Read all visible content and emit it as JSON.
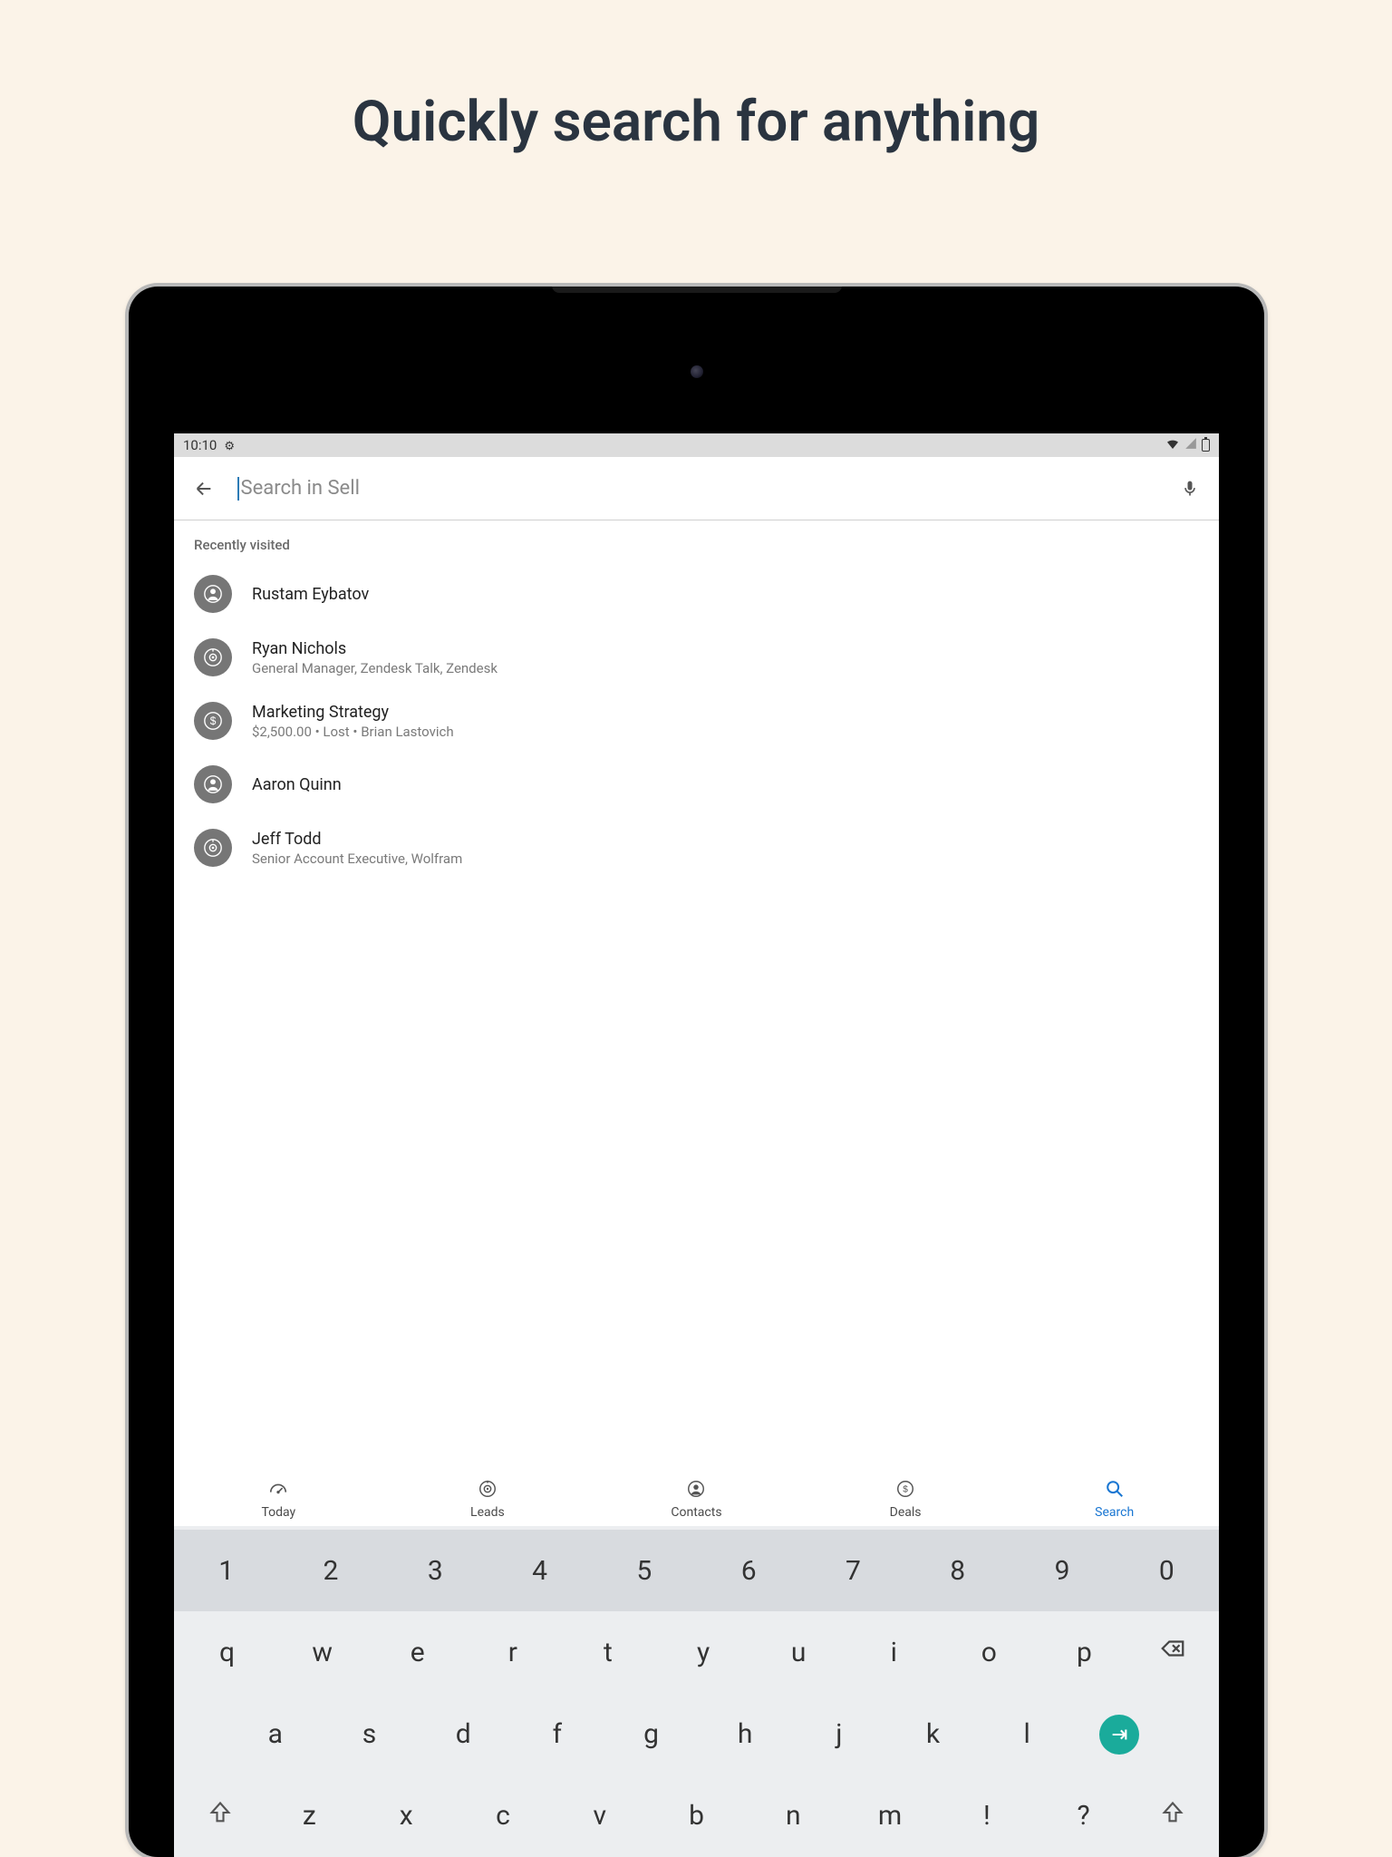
{
  "headline": "Quickly search for anything",
  "status": {
    "time": "10:10"
  },
  "search": {
    "placeholder": "Search in Sell"
  },
  "section_header": "Recently visited",
  "items": [
    {
      "icon": "contact",
      "title": "Rustam Eybatov",
      "subtitle": ""
    },
    {
      "icon": "lead",
      "title": "Ryan Nichols",
      "subtitle": "General Manager, Zendesk Talk, Zendesk"
    },
    {
      "icon": "deal",
      "title": "Marketing Strategy",
      "subtitle": "$2,500.00 • Lost • Brian Lastovich"
    },
    {
      "icon": "contact",
      "title": "Aaron Quinn",
      "subtitle": ""
    },
    {
      "icon": "lead",
      "title": "Jeff Todd",
      "subtitle": "Senior Account Executive, Wolfram"
    }
  ],
  "nav": {
    "items": [
      {
        "label": "Today",
        "icon": "gauge"
      },
      {
        "label": "Leads",
        "icon": "lead"
      },
      {
        "label": "Contacts",
        "icon": "contact"
      },
      {
        "label": "Deals",
        "icon": "deal"
      },
      {
        "label": "Search",
        "icon": "search",
        "active": true
      }
    ]
  },
  "keyboard": {
    "row1": [
      "1",
      "2",
      "3",
      "4",
      "5",
      "6",
      "7",
      "8",
      "9",
      "0"
    ],
    "row2": [
      "q",
      "w",
      "e",
      "r",
      "t",
      "y",
      "u",
      "i",
      "o",
      "p"
    ],
    "row3": [
      "a",
      "s",
      "d",
      "f",
      "g",
      "h",
      "j",
      "k",
      "l"
    ],
    "row4": [
      "z",
      "x",
      "c",
      "v",
      "b",
      "n",
      "m",
      "!",
      "?"
    ]
  }
}
